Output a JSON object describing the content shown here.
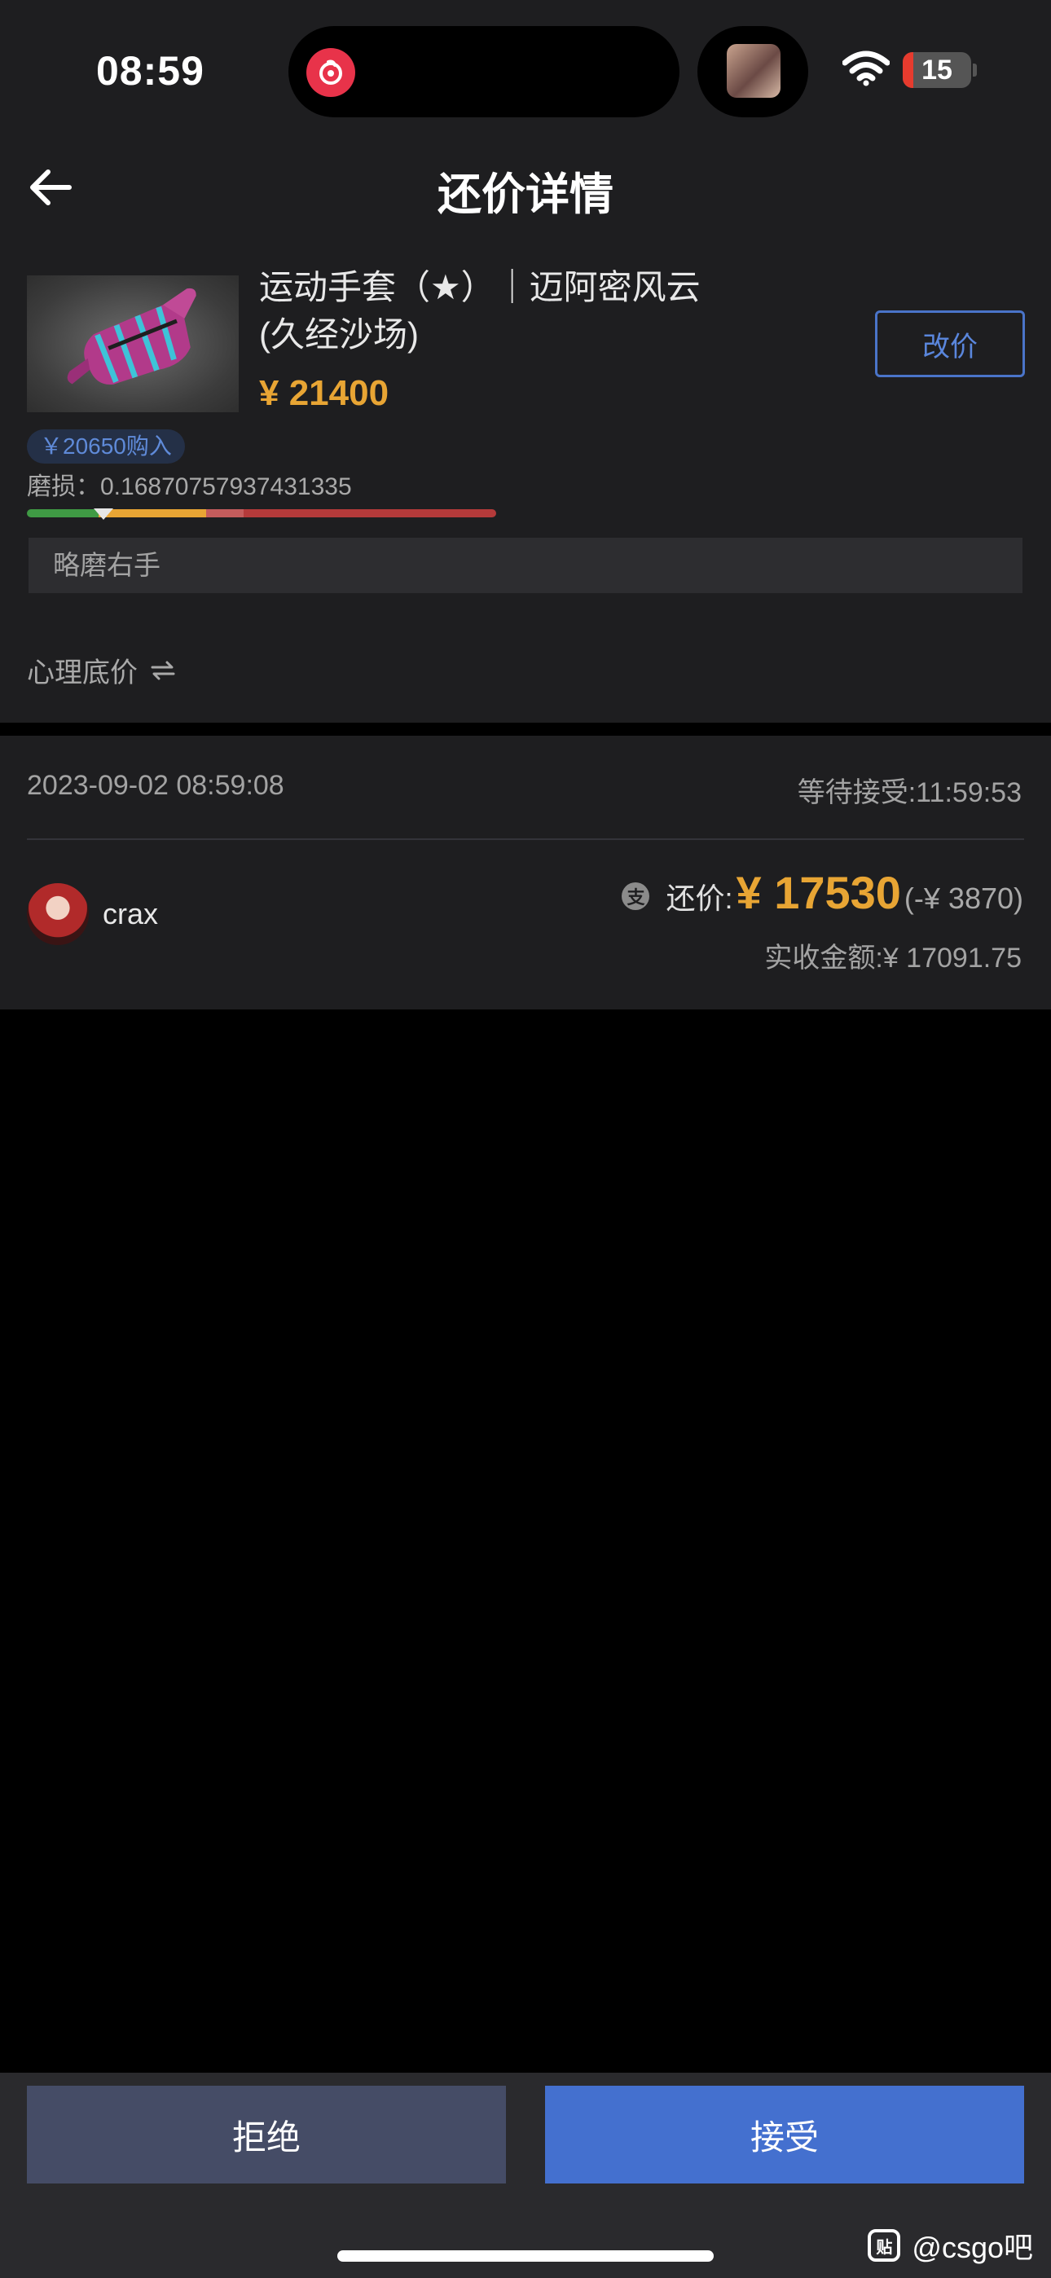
{
  "status_bar": {
    "time": "08:59",
    "battery": {
      "level_percent": 15,
      "label": "15"
    }
  },
  "nav": {
    "title": "还价详情"
  },
  "product": {
    "name": "运动手套（★）｜迈阿密风云(久经沙场)",
    "price": "¥ 21400",
    "change_price_label": "改价",
    "buy_price_badge": "￥20650购入",
    "wear_label": "磨损：",
    "wear_value": "0.16870757937431335",
    "wear_fraction": 0.1687,
    "wear_bar": {
      "segment_colors": [
        "#3f9a44",
        "#e8a534",
        "#c45c5c",
        "#b43a3a"
      ]
    },
    "note": "略磨右手",
    "reserve_price_label": "心理底价"
  },
  "offer": {
    "date": "2023-09-02 08:59:08",
    "waiting": "等待接受:11:59:53",
    "username": "crax",
    "offer_label": "还价:",
    "offer_price": "¥ 17530",
    "offer_diff": "(-¥ 3870)",
    "actual_received": "实收金额:¥ 17091.75"
  },
  "actions": {
    "reject_label": "拒绝",
    "accept_label": "接受"
  },
  "watermark": {
    "text": "@csgo吧"
  },
  "colors": {
    "accent_orange": "#e8a534",
    "accent_blue": "#4470cf",
    "reject_gray": "#454c66",
    "background": "#1e1e20"
  }
}
